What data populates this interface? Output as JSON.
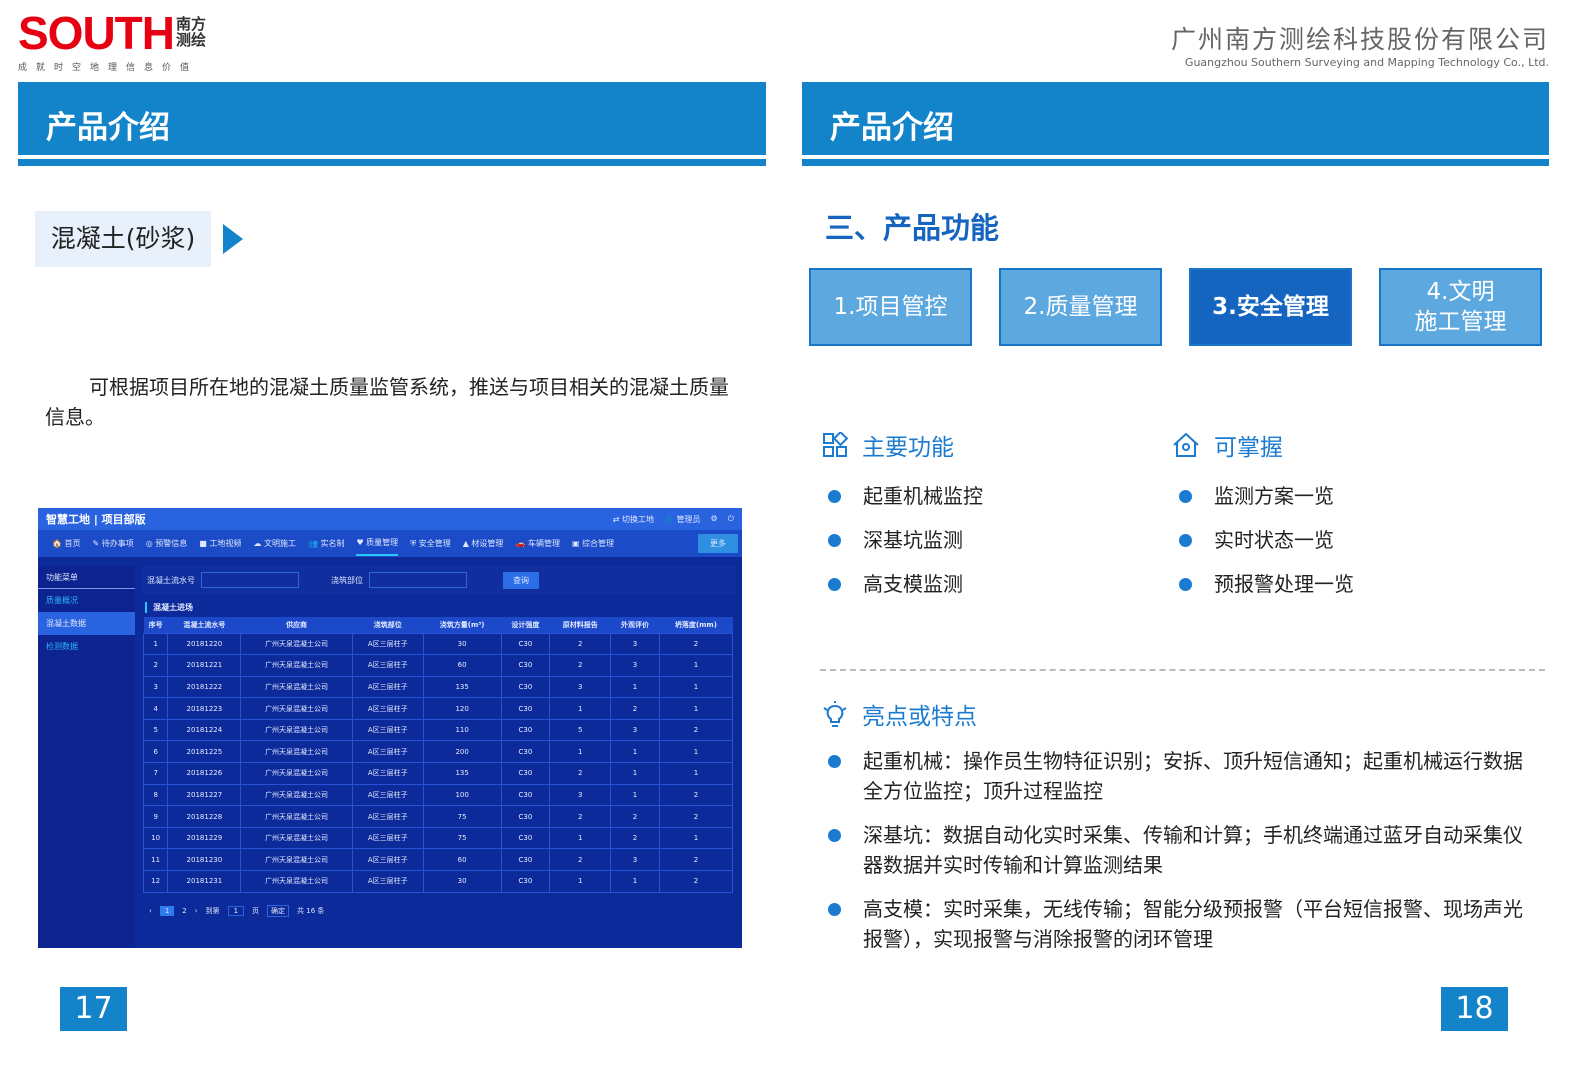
{
  "logo": {
    "text": "SOUTH",
    "cn": "南方测绘",
    "slogan": "成就时空地理信息价值"
  },
  "company": {
    "cn": "广州南方测绘科技股份有限公司",
    "en": "Guangzhou Southern Surveying and Mapping Technology Co., Ltd."
  },
  "left": {
    "header": "产品介绍",
    "tag": "混凝土(砂浆)",
    "desc": "可根据项目所在地的混凝土质量监管系统，推送与项目相关的混凝土质量信息。",
    "page": "17"
  },
  "screenshot": {
    "title": "智慧工地 | 项目部版",
    "top_actions": [
      "⇄ 切换工地",
      "👤 管理员",
      "⚙",
      "⏻"
    ],
    "nav": [
      "🏠 首页",
      "✎ 待办事项",
      "◎ 预警信息",
      "■ 工地视频",
      "☁ 文明施工",
      "👥 实名制",
      "♥ 质量管理",
      "⛨ 安全管理",
      "▲ 材设管理",
      "🚗 车辆管理",
      "▣ 综合管理"
    ],
    "more": "更多",
    "side_title": "功能菜单",
    "side": [
      "质量概况",
      "混凝土数据",
      "检测数据"
    ],
    "q1": "混凝土流水号",
    "q2": "浇筑部位",
    "query": "查询",
    "table_title": "混凝土进场",
    "columns": [
      "序号",
      "混凝土流水号",
      "供应商",
      "浇筑部位",
      "浇筑方量(m³)",
      "设计强度",
      "原材料报告",
      "外观评价",
      "坍落度(mm)"
    ],
    "rows": [
      [
        "1",
        "20181220",
        "广州天泉混凝土公司",
        "A区三层柱子",
        "30",
        "C30",
        "2",
        "3",
        "2"
      ],
      [
        "2",
        "20181221",
        "广州天泉混凝土公司",
        "A区三层柱子",
        "60",
        "C30",
        "2",
        "3",
        "1"
      ],
      [
        "3",
        "20181222",
        "广州天泉混凝土公司",
        "A区三层柱子",
        "135",
        "C30",
        "3",
        "1",
        "1"
      ],
      [
        "4",
        "20181223",
        "广州天泉混凝土公司",
        "A区三层柱子",
        "120",
        "C30",
        "1",
        "2",
        "1"
      ],
      [
        "5",
        "20181224",
        "广州天泉混凝土公司",
        "A区三层柱子",
        "110",
        "C30",
        "5",
        "3",
        "2"
      ],
      [
        "6",
        "20181225",
        "广州天泉混凝土公司",
        "A区三层柱子",
        "200",
        "C30",
        "1",
        "1",
        "1"
      ],
      [
        "7",
        "20181226",
        "广州天泉混凝土公司",
        "A区三层柱子",
        "135",
        "C30",
        "2",
        "1",
        "1"
      ],
      [
        "8",
        "20181227",
        "广州天泉混凝土公司",
        "A区三层柱子",
        "100",
        "C30",
        "3",
        "1",
        "2"
      ],
      [
        "9",
        "20181228",
        "广州天泉混凝土公司",
        "A区三层柱子",
        "75",
        "C30",
        "2",
        "2",
        "2"
      ],
      [
        "10",
        "20181229",
        "广州天泉混凝土公司",
        "A区三层柱子",
        "75",
        "C30",
        "1",
        "2",
        "1"
      ],
      [
        "11",
        "20181230",
        "广州天泉混凝土公司",
        "A区三层柱子",
        "60",
        "C30",
        "2",
        "3",
        "2"
      ],
      [
        "12",
        "20181231",
        "广州天泉混凝土公司",
        "A区三层柱子",
        "30",
        "C30",
        "1",
        "1",
        "2"
      ]
    ],
    "pager": {
      "prev": "‹",
      "p1": "1",
      "p2": "2",
      "next": "›",
      "goto": "到第",
      "input": "1",
      "page": "页",
      "ok": "确定",
      "total": "共 16 条"
    }
  },
  "right": {
    "header": "产品介绍",
    "section": "三、产品功能",
    "tabs": [
      "1.项目管控",
      "2.质量管理",
      "3.安全管理",
      "4.文明\n施工管理"
    ],
    "main_title": "主要功能",
    "main_items": [
      "起重机械监控",
      "深基坑监测",
      "高支模监测"
    ],
    "grasp_title": "可掌握",
    "grasp_items": [
      "监测方案一览",
      "实时状态一览",
      "预报警处理一览"
    ],
    "feat_title": "亮点或特点",
    "features": [
      "起重机械：操作员生物特征识别；安拆、顶升短信通知；起重机械运行数据全方位监控；顶升过程监控",
      "深基坑：数据自动化实时采集、传输和计算；手机终端通过蓝牙自动采集仪器数据并实时传输和计算监测结果",
      "高支模：实时采集，无线传输；智能分级预报警（平台短信报警、现场声光报警），实现报警与消除报警的闭环管理"
    ],
    "page": "18"
  },
  "colors": {
    "brand": "#1384c9",
    "active": "#1565c0",
    "logo": "#e60012"
  }
}
